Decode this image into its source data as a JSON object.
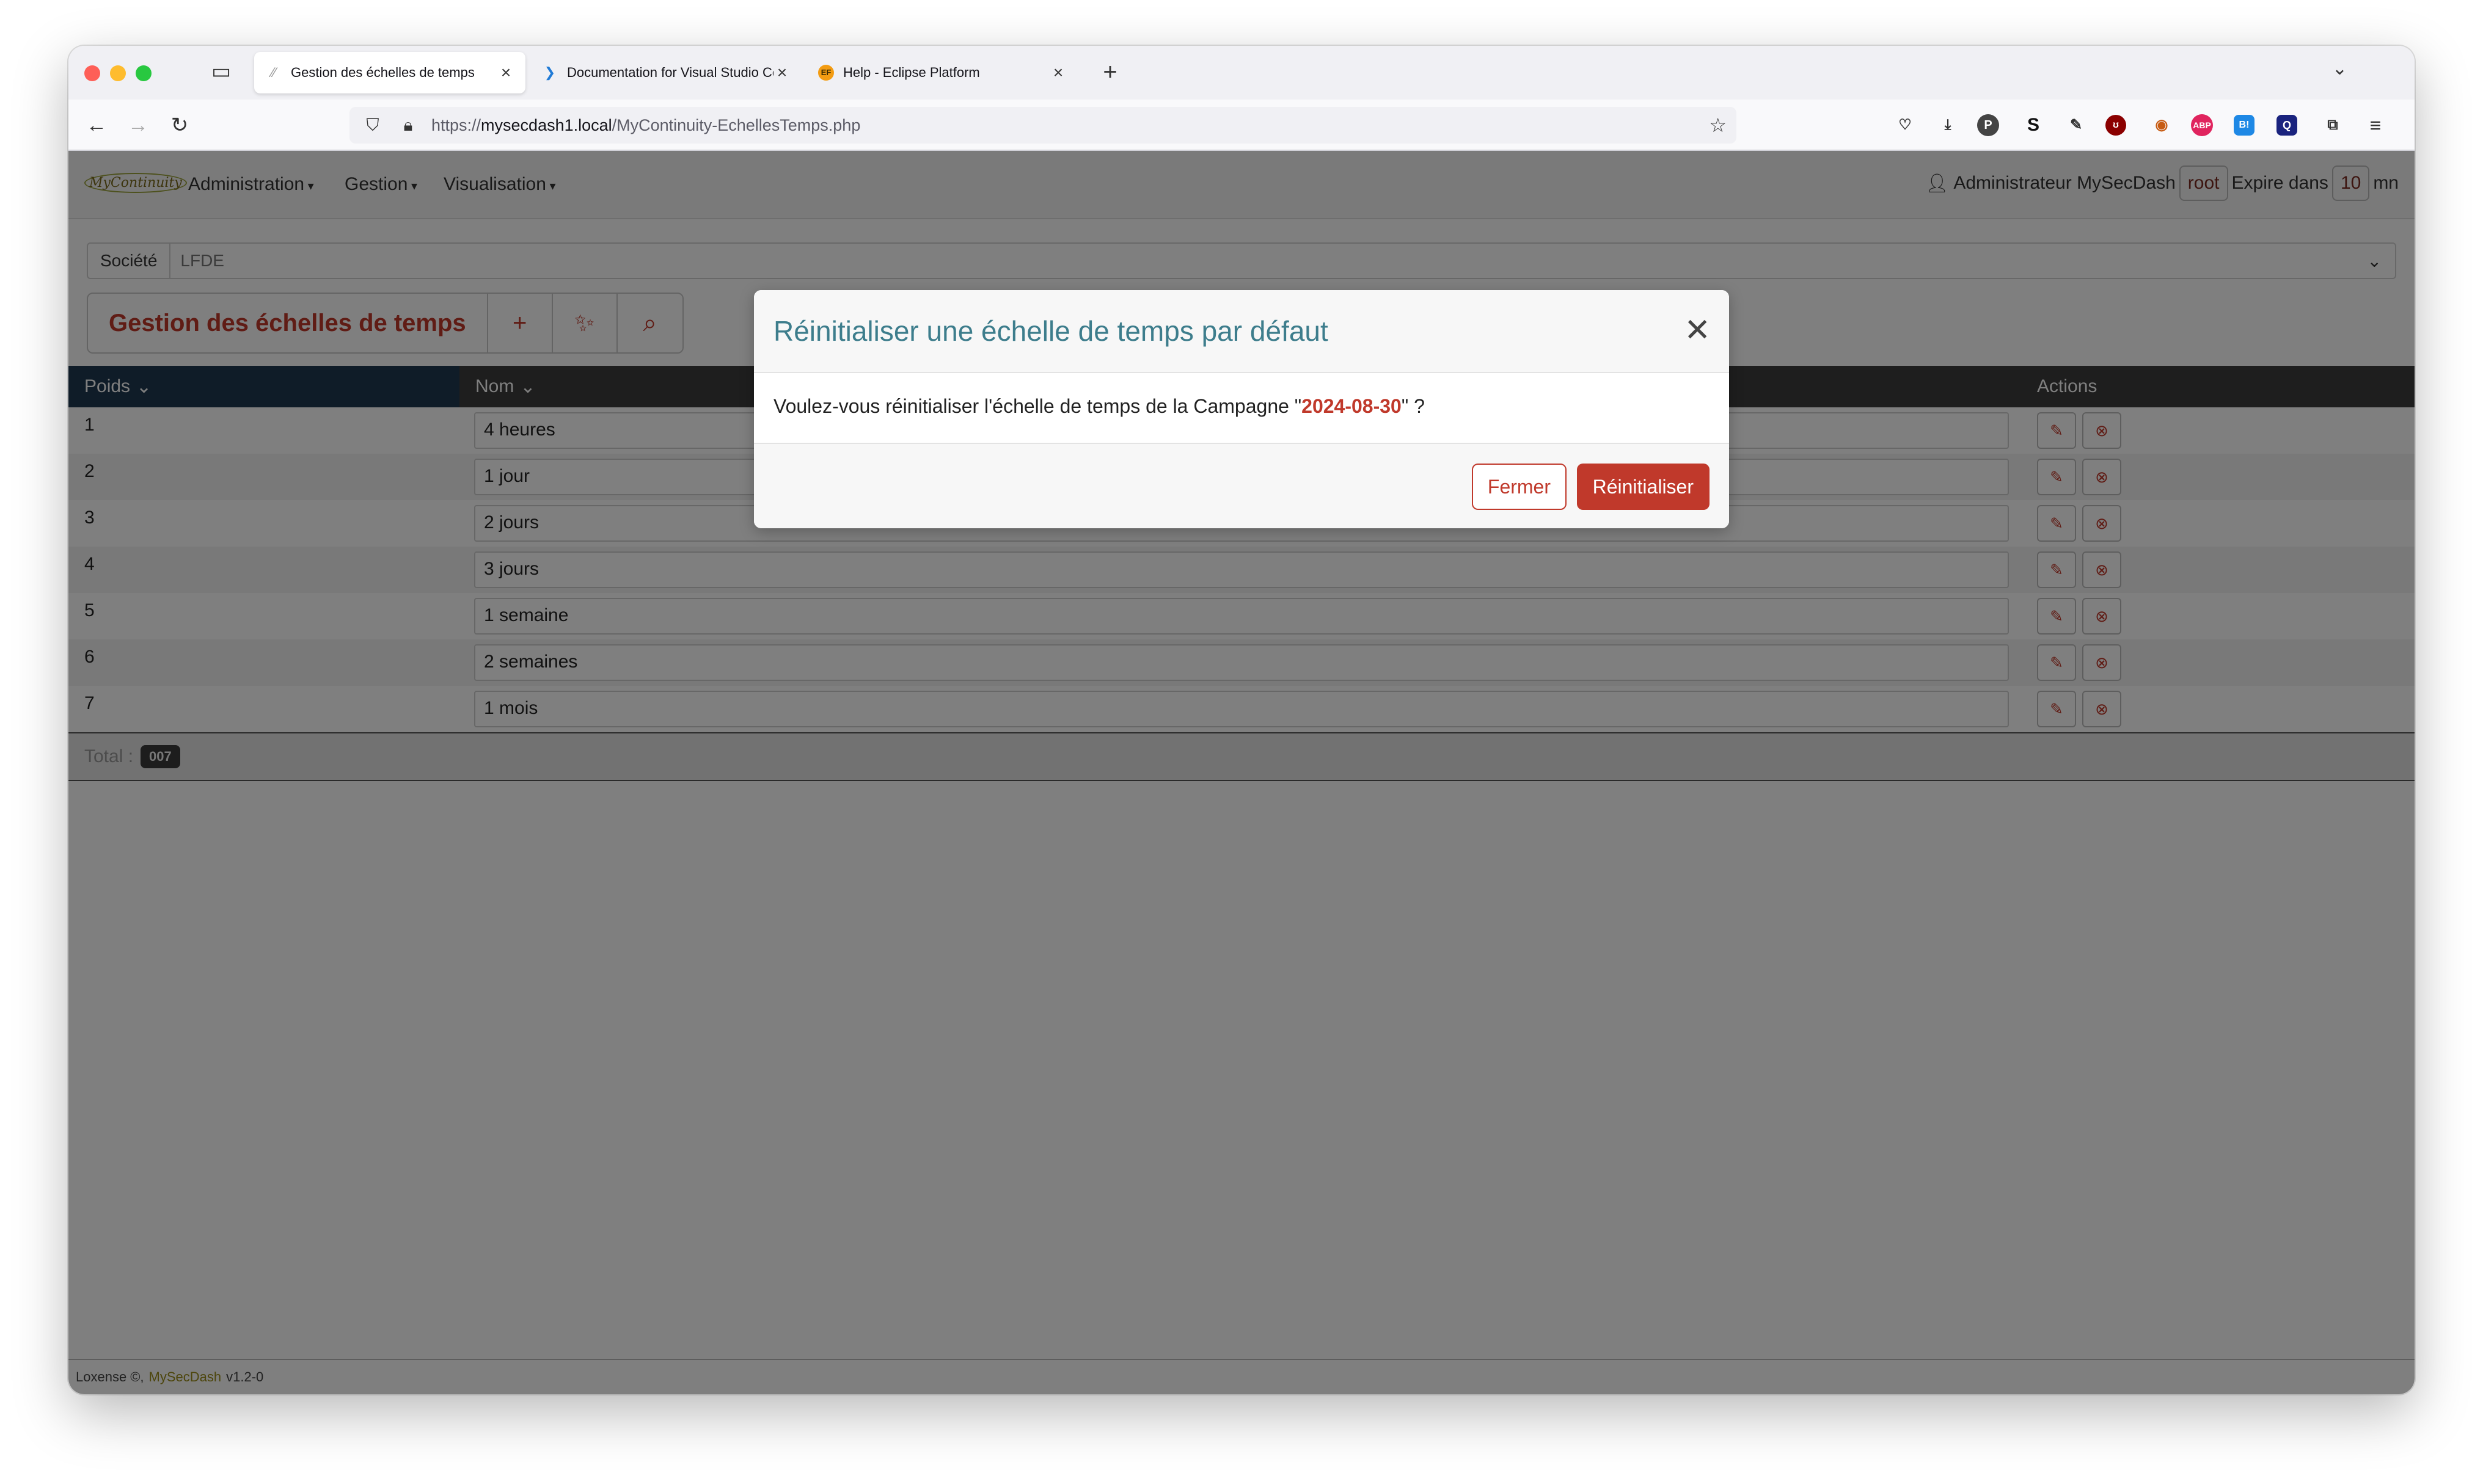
{
  "browser": {
    "tabs": [
      {
        "title": "Gestion des échelles de temps",
        "favicon": "mycontinuity-favicon"
      },
      {
        "title": "Documentation for Visual Studio Code",
        "favicon": "vscode-favicon"
      },
      {
        "title": "Help - Eclipse Platform",
        "favicon": "eclipse-favicon"
      }
    ],
    "url_prefix": "https://",
    "url_host": "mysecdash1.local",
    "url_path": "/MyContinuity-EchellesTemps.php"
  },
  "app": {
    "logo": "MyContinuity",
    "menus": [
      "Administration",
      "Gestion",
      "Visualisation"
    ],
    "user_label": "Administrateur MySecDash",
    "user_login": "root",
    "expire_label": "Expire dans",
    "expire_value": "10",
    "expire_unit": "mn",
    "societe_label": "Société",
    "societe_value": "LFDE",
    "page_title": "Gestion des échelles de temps",
    "table": {
      "headers": {
        "poids": "Poids",
        "nom": "Nom",
        "actions": "Actions"
      },
      "rows": [
        {
          "poids": "1",
          "nom": "4 heures"
        },
        {
          "poids": "2",
          "nom": "1 jour"
        },
        {
          "poids": "3",
          "nom": "2 jours"
        },
        {
          "poids": "4",
          "nom": "3 jours"
        },
        {
          "poids": "5",
          "nom": "1 semaine"
        },
        {
          "poids": "6",
          "nom": "2 semaines"
        },
        {
          "poids": "7",
          "nom": "1 mois"
        }
      ],
      "total_label": "Total :",
      "total_value": "007"
    },
    "footer": {
      "company": "Loxense",
      "brand": "MySecDash",
      "version": "v1.2-0"
    }
  },
  "modal": {
    "title": "Réinitialiser une échelle de temps par défaut",
    "body_prefix": "Voulez-vous réinitialiser l'échelle de temps de la Campagne \"",
    "body_date": "2024-08-30",
    "body_suffix": "\" ?",
    "close_label": "Fermer",
    "confirm_label": "Réinitialiser"
  },
  "colors": {
    "accent": "#c0392b",
    "modal_title": "#3d7d8c",
    "header_dark": "#3d3d3d",
    "sort_header": "#1f3950"
  }
}
